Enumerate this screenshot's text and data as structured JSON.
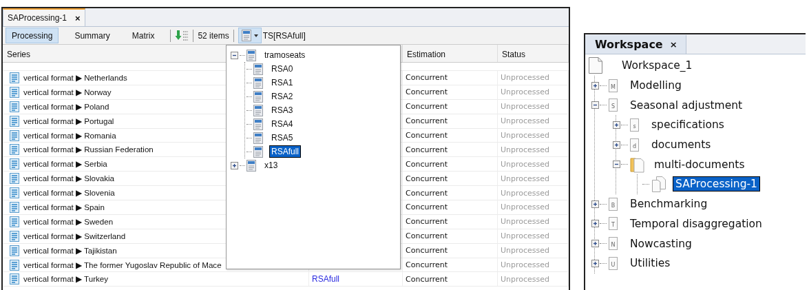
{
  "editor": {
    "tab": {
      "title": "SAProcessing-1",
      "close": "×"
    },
    "toolbar": {
      "views": [
        {
          "label": "Processing",
          "selected": true
        },
        {
          "label": "Summary",
          "selected": false
        },
        {
          "label": "Matrix",
          "selected": false
        }
      ],
      "count": "52 items",
      "spec_label": "TS[RSAfull]"
    },
    "table": {
      "columns": [
        "Series",
        "Estimation",
        "Status"
      ],
      "rows": [
        {
          "series": "vertical format ▶ Netherlands",
          "estimation": "Concurrent",
          "status": "Unprocessed"
        },
        {
          "series": "vertical format ▶ Norway",
          "estimation": "Concurrent",
          "status": "Unprocessed"
        },
        {
          "series": "vertical format ▶ Poland",
          "estimation": "Concurrent",
          "status": "Unprocessed"
        },
        {
          "series": "vertical format ▶ Portugal",
          "estimation": "Concurrent",
          "status": "Unprocessed"
        },
        {
          "series": "vertical format ▶ Romania",
          "estimation": "Concurrent",
          "status": "Unprocessed"
        },
        {
          "series": "vertical format ▶ Russian Federation",
          "estimation": "Concurrent",
          "status": "Unprocessed"
        },
        {
          "series": "vertical format ▶ Serbia",
          "estimation": "Concurrent",
          "status": "Unprocessed"
        },
        {
          "series": "vertical format ▶ Slovakia",
          "estimation": "Concurrent",
          "status": "Unprocessed"
        },
        {
          "series": "vertical format ▶ Slovenia",
          "estimation": "Concurrent",
          "status": "Unprocessed"
        },
        {
          "series": "vertical format ▶ Spain",
          "estimation": "Concurrent",
          "status": "Unprocessed"
        },
        {
          "series": "vertical format ▶ Sweden",
          "estimation": "Concurrent",
          "status": "Unprocessed"
        },
        {
          "series": "vertical format ▶ Switzerland",
          "estimation": "Concurrent",
          "status": "Unprocessed"
        },
        {
          "series": "vertical format ▶ Tajikistan",
          "estimation": "Concurrent",
          "status": "Unprocessed"
        },
        {
          "series": "vertical format ▶ The former Yugoslav Republic of Mace",
          "estimation": "Concurrent",
          "status": "Unprocessed"
        },
        {
          "series": "vertical format ▶ Turkey",
          "column_2": "RSAfull",
          "estimation": "Concurrent",
          "status": "Unprocessed"
        }
      ]
    },
    "spec_popup": {
      "tree": [
        {
          "label": "tramoseats",
          "expanded": true,
          "selected": false,
          "children": [
            {
              "label": "RSA0",
              "selected": false
            },
            {
              "label": "RSA1",
              "selected": false
            },
            {
              "label": "RSA2",
              "selected": false
            },
            {
              "label": "RSA3",
              "selected": false
            },
            {
              "label": "RSA4",
              "selected": false
            },
            {
              "label": "RSA5",
              "selected": false
            },
            {
              "label": "RSAfull",
              "selected": true
            }
          ]
        },
        {
          "label": "x13",
          "expanded": false,
          "selected": false
        }
      ]
    }
  },
  "workspace": {
    "tab": {
      "title": "Workspace",
      "close": "×"
    },
    "tree": {
      "label": "Workspace_1",
      "kind": "document",
      "selected": false,
      "children": [
        {
          "label": "Modelling",
          "kind": "letter",
          "icon_letter": "M",
          "expanded": false,
          "selected": false
        },
        {
          "label": "Seasonal adjustment",
          "kind": "letter",
          "icon_letter": "S",
          "expanded": true,
          "selected": false,
          "children": [
            {
              "label": "specifications",
              "kind": "letter",
              "icon_letter": "s",
              "expanded": false,
              "selected": false
            },
            {
              "label": "documents",
              "kind": "letter",
              "icon_letter": "d",
              "expanded": false,
              "selected": false
            },
            {
              "label": "multi-documents",
              "kind": "folder",
              "expanded": true,
              "selected": false,
              "children": [
                {
                  "label": "SAProcessing-1",
                  "kind": "multi",
                  "selected": true
                }
              ]
            }
          ]
        },
        {
          "label": "Benchmarking",
          "kind": "letter",
          "icon_letter": "B",
          "expanded": false,
          "selected": false
        },
        {
          "label": "Temporal disaggregation",
          "kind": "letter",
          "icon_letter": "T",
          "expanded": false,
          "selected": false
        },
        {
          "label": "Nowcasting",
          "kind": "letter",
          "icon_letter": "N",
          "expanded": false,
          "selected": false
        },
        {
          "label": "Utilities",
          "kind": "letter",
          "icon_letter": "U",
          "expanded": false,
          "selected": false
        }
      ]
    }
  }
}
